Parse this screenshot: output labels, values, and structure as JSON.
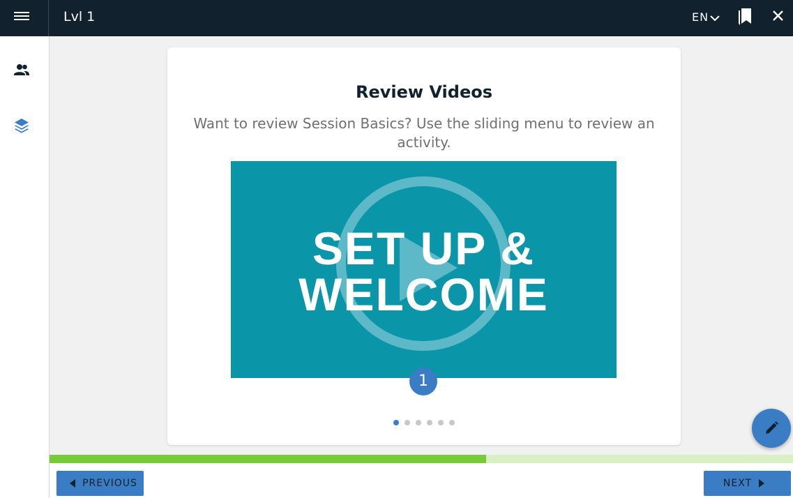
{
  "header": {
    "title": "Lvl 1",
    "language": "EN"
  },
  "icons": {
    "menu": "hamburger-menu-icon",
    "language_dropdown": "chevron-down-icon",
    "bookmark": "bookmarks-icon",
    "close": "close-icon",
    "participants": "people-icon",
    "layers": "layers-icon",
    "edit": "pencil-icon",
    "play": "play-icon"
  },
  "card": {
    "title": "Review Videos",
    "subtitle": "Want to review Session Basics? Use the sliding menu to review an activity.",
    "video": {
      "line1": "SET UP &",
      "line2": "WELCOME"
    },
    "slide_number": "1",
    "carousel": {
      "total": 6,
      "active_index": 0
    }
  },
  "progress": {
    "percent": 58.7
  },
  "footer": {
    "previous_label": "PREVIOUS",
    "next_label": "NEXT"
  },
  "colors": {
    "header_bg": "#12212e",
    "accent_blue": "#3b7dc4",
    "video_teal": "#0b95a8",
    "progress_green": "#7ac93a",
    "progress_track": "#d8f0c4"
  }
}
